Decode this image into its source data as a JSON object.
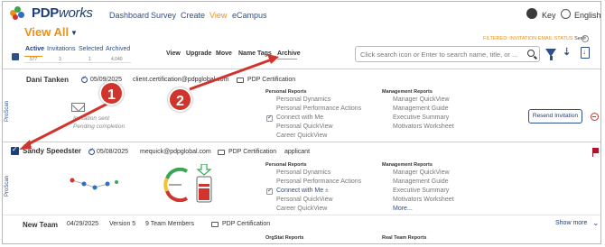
{
  "app": {
    "logo": "PDPworks",
    "logo_prefix": "PDP",
    "logo_suffix": "works"
  },
  "nav": {
    "items": [
      "Dashboard",
      "Survey",
      "Create",
      "View",
      "eCampus"
    ],
    "active": "View",
    "user": "Key",
    "language": "English"
  },
  "header": {
    "title": "View All",
    "filter_label": "FILTERED: INVITATION EMAIL STATUS",
    "filter_value": "Sent",
    "tabs": [
      {
        "label": "Active",
        "count": "577"
      },
      {
        "label": "Invitations",
        "count": "3"
      },
      {
        "label": "Selected",
        "count": "1"
      },
      {
        "label": "Archived",
        "count": "4,040"
      }
    ],
    "actions": [
      "View",
      "Upgrade",
      "Move",
      "Name Tags",
      "Archive"
    ],
    "search_placeholder": "Click search icon or Enter to search name, title, or ..."
  },
  "rows": [
    {
      "name": "Dani Tanken",
      "date": "05/09/2025",
      "email": "client.certification@pdpglobal.com",
      "certification": "PDP Certification",
      "side_label": "ProScan",
      "status_lines": [
        "Invitation sent",
        "Pending completion"
      ],
      "personal_reports_title": "Personal Reports",
      "personal_reports": [
        "Personal Dynamics",
        "Personal Performance Actions",
        "Connect with Me",
        "Personal QuickView",
        "Career QuickView"
      ],
      "management_reports_title": "Management Reports",
      "management_reports": [
        "Manager QuickView",
        "Management Guide",
        "Executive Summary",
        "Motivators Worksheet"
      ],
      "resend_label": "Resend Invitation"
    },
    {
      "name": "Sandy Speedster",
      "date": "05/08/2025",
      "email": "mequick@pdpglobal.com",
      "certification": "PDP Certification",
      "tag": "applicant",
      "side_label": "ProScan",
      "personal_reports_title": "Personal Reports",
      "personal_reports": [
        "Personal Dynamics",
        "Personal Performance Actions",
        "Connect with Me",
        "Personal QuickView",
        "Career QuickView"
      ],
      "connect_suffix": "±",
      "management_reports_title": "Management Reports",
      "management_reports": [
        "Manager QuickView",
        "Management Guide",
        "Executive Summary",
        "Motivators Worksheet"
      ],
      "more_label": "More..."
    },
    {
      "name": "New Team",
      "date": "04/29/2025",
      "version": "Version 5",
      "members": "9 Team Members",
      "certification": "PDP Certification",
      "show_more": "Show more",
      "orgstat_title": "OrgStat Reports",
      "real_team_title": "Real Team Reports"
    }
  ],
  "annotations": {
    "badge_1": "1",
    "badge_2": "2"
  },
  "colors": {
    "brand_blue": "#1f3f78",
    "accent_orange": "#e8921c",
    "annotation_red": "#d0342c"
  }
}
